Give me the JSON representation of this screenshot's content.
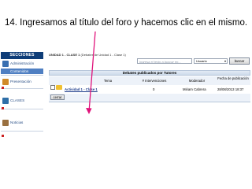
{
  "caption": "14. Ingresamos al título del foro y hacemos clic en el mismo.",
  "sidebar": {
    "header": "SECCIONES",
    "items": [
      {
        "label": "Administración",
        "icon": "admin-icon",
        "color": "#3a6fb0"
      },
      {
        "label": "Presentación",
        "icon": "presentation-icon",
        "color": "#d08a2a"
      },
      {
        "label": "CLASES",
        "icon": "classes-icon",
        "color": "#2f6fa8"
      },
      {
        "label": "Noticias",
        "icon": "news-icon",
        "color": "#9a7040"
      }
    ],
    "sub_item": "Contenidos"
  },
  "breadcrumb": {
    "unit": "UNIDAD 1 - CLASE 1",
    "debates": "(Debates de Unidad 1 - Clase 1)"
  },
  "search": {
    "placeholder": "Ingresa el texto a buscar en...",
    "select_value": "Usuario",
    "button": "buscar"
  },
  "table": {
    "title": "Debates publicados por Tutores",
    "columns": [
      "Tema",
      "# Intervenciones",
      "Moderador",
      "Fecha de publicación"
    ],
    "rows": [
      {
        "tema": "Actividad 1 - Clase 1",
        "intervenciones": "0",
        "moderador": "Miriam Cabrera",
        "fecha": "28/08/2013 18:37"
      }
    ],
    "close_button": "cerrar"
  },
  "colors": {
    "header_bg": "#0f3d78",
    "link": "#1a3a8a",
    "annotation_arrow": "#e0127a"
  }
}
